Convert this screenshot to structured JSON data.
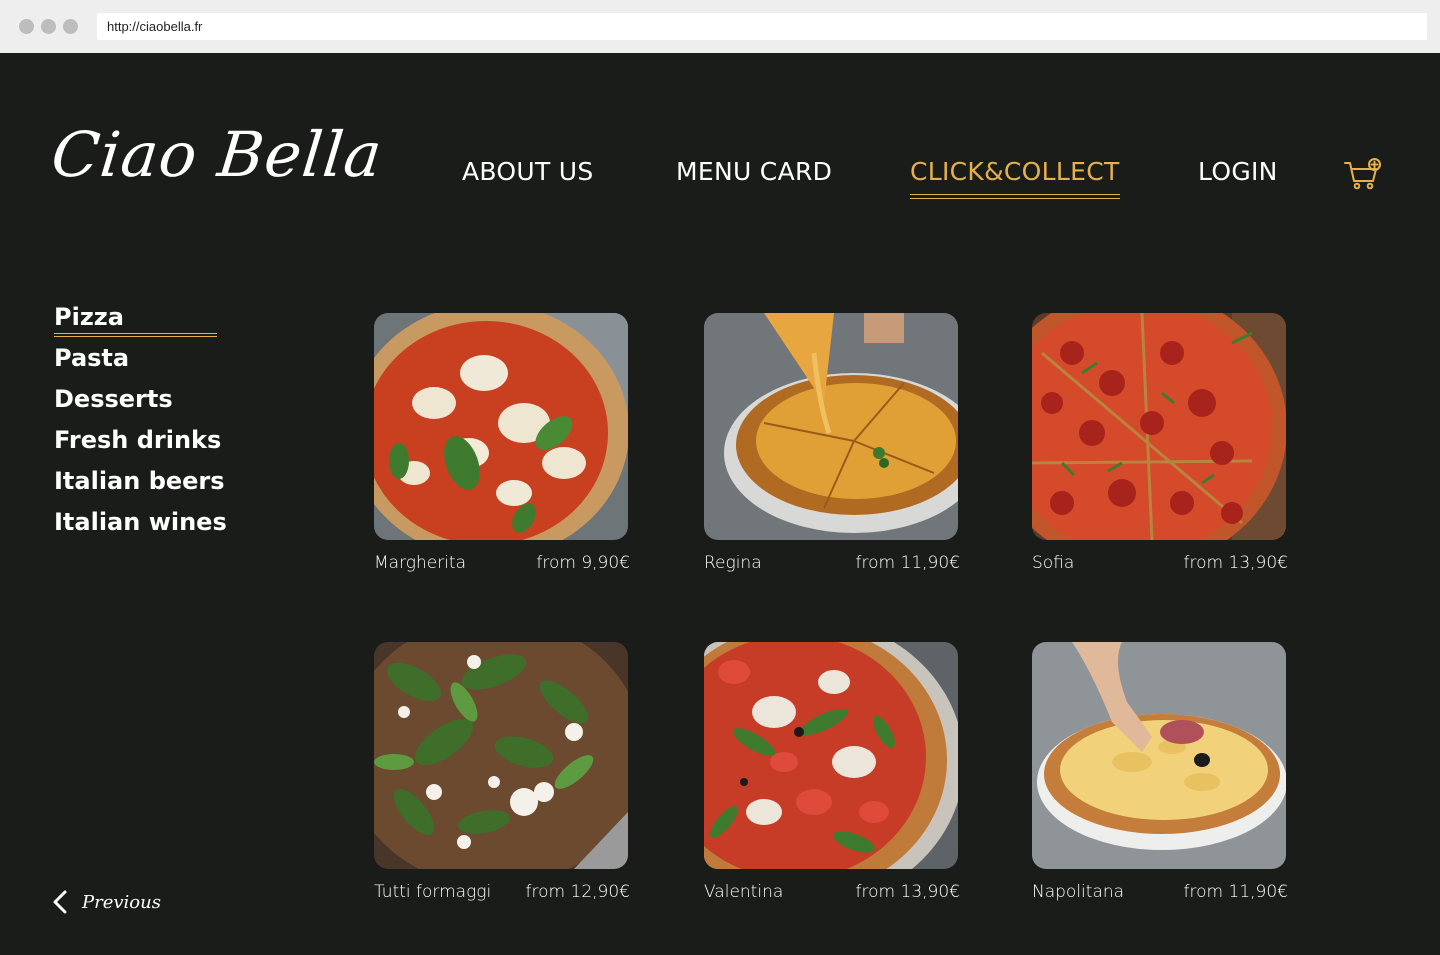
{
  "browser": {
    "url": "http://ciaobella.fr"
  },
  "brand": {
    "logo_text": "Ciao Bella",
    "accent_color": "#e8b04a",
    "background_color": "#1a1c1a"
  },
  "nav": {
    "items": [
      {
        "label": "ABOUT US",
        "active": false
      },
      {
        "label": "MENU CARD",
        "active": false
      },
      {
        "label": "CLICK&COLLECT",
        "active": true
      },
      {
        "label": "LOGIN",
        "active": false
      }
    ],
    "cart_icon": "cart-add-icon"
  },
  "sidebar": {
    "categories": [
      {
        "label": "Pizza",
        "active": true
      },
      {
        "label": "Pasta",
        "active": false
      },
      {
        "label": "Desserts",
        "active": false
      },
      {
        "label": "Fresh drinks",
        "active": false
      },
      {
        "label": "Italian beers",
        "active": false
      },
      {
        "label": "Italian wines",
        "active": false
      }
    ],
    "previous_label": "Previous",
    "previous_icon": "chevron-left-icon"
  },
  "products": [
    {
      "name": "Margherita",
      "price": "from 9,90€",
      "image": "pizza-margherita-photo"
    },
    {
      "name": "Regina",
      "price": "from 11,90€",
      "image": "pizza-regina-photo"
    },
    {
      "name": "Sofia",
      "price": "from 13,90€",
      "image": "pizza-sofia-photo"
    },
    {
      "name": "Tutti formaggi",
      "price": "from 12,90€",
      "image": "pizza-tutti-formaggi-photo"
    },
    {
      "name": "Valentina",
      "price": "from 13,90€",
      "image": "pizza-valentina-photo"
    },
    {
      "name": "Napolitana",
      "price": "from 11,90€",
      "image": "pizza-napolitana-photo"
    }
  ]
}
